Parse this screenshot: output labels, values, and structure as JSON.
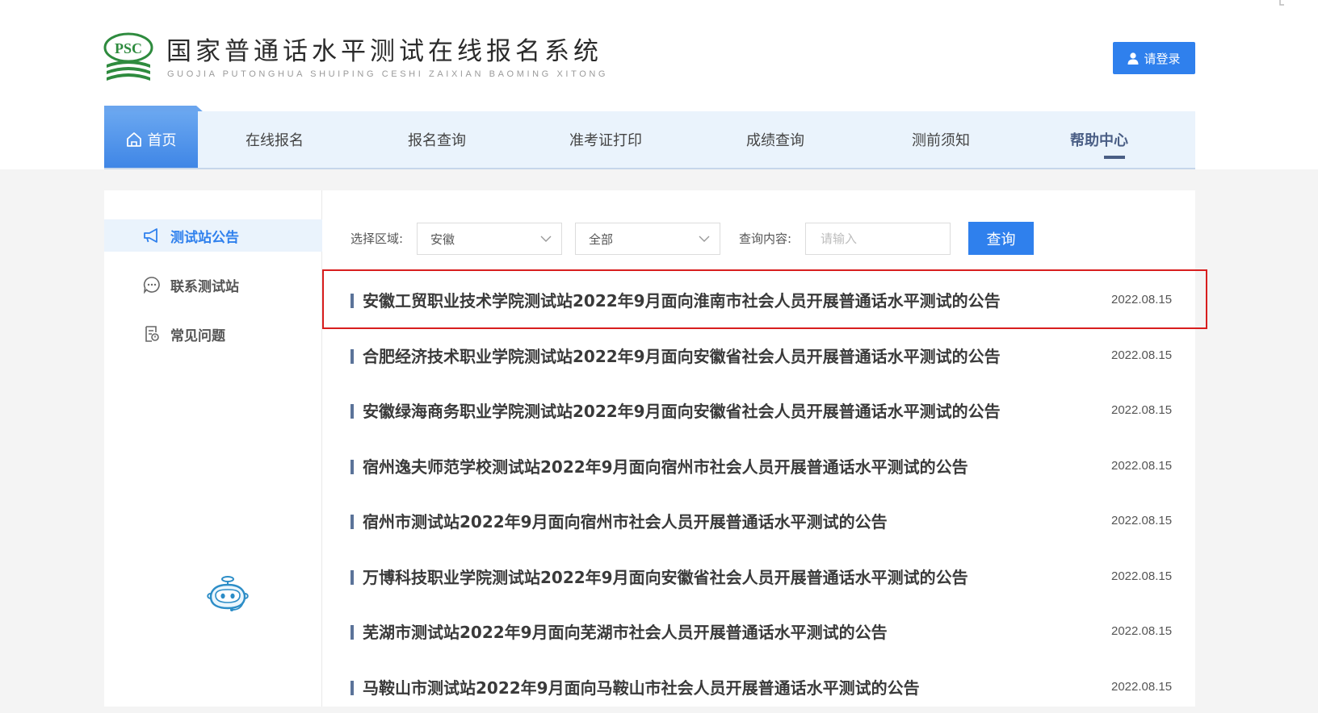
{
  "header": {
    "title": "国家普通话水平测试在线报名系统",
    "subtitle": "GUOJIA PUTONGHUA SHUIPING CESHI ZAIXIAN BAOMING XITONG",
    "logo_text": "PSC",
    "login_label": "请登录",
    "login_icon": "user-icon"
  },
  "nav": {
    "items": [
      {
        "label": "首页",
        "icon": "home-icon"
      },
      {
        "label": "在线报名"
      },
      {
        "label": "报名查询"
      },
      {
        "label": "准考证打印"
      },
      {
        "label": "成绩查询"
      },
      {
        "label": "测前须知"
      },
      {
        "label": "帮助中心"
      }
    ],
    "active_index": 0,
    "selected_index": 6
  },
  "sidebar": {
    "items": [
      {
        "label": "测试站公告",
        "icon": "megaphone-icon"
      },
      {
        "label": "联系测试站",
        "icon": "chat-bubble-icon"
      },
      {
        "label": "常见问题",
        "icon": "faq-document-icon"
      }
    ],
    "active_index": 0,
    "assistant_icon": "robot-assistant-icon"
  },
  "filters": {
    "region_label": "选择区域:",
    "province_value": "安徽",
    "city_value": "全部",
    "query_label": "查询内容:",
    "query_placeholder": "请输入",
    "query_value": "",
    "search_label": "查询"
  },
  "announcements": [
    {
      "title": "安徽工贸职业技术学院测试站2022年9月面向淮南市社会人员开展普通话水平测试的公告",
      "date": "2022.08.15",
      "highlighted": true
    },
    {
      "title": "合肥经济技术职业学院测试站2022年9月面向安徽省社会人员开展普通话水平测试的公告",
      "date": "2022.08.15"
    },
    {
      "title": "安徽绿海商务职业学院测试站2022年9月面向安徽省社会人员开展普通话水平测试的公告",
      "date": "2022.08.15"
    },
    {
      "title": "宿州逸夫师范学校测试站2022年9月面向宿州市社会人员开展普通话水平测试的公告",
      "date": "2022.08.15"
    },
    {
      "title": "宿州市测试站2022年9月面向宿州市社会人员开展普通话水平测试的公告",
      "date": "2022.08.15"
    },
    {
      "title": "万博科技职业学院测试站2022年9月面向安徽省社会人员开展普通话水平测试的公告",
      "date": "2022.08.15"
    },
    {
      "title": "芜湖市测试站2022年9月面向芜湖市社会人员开展普通话水平测试的公告",
      "date": "2022.08.15"
    },
    {
      "title": "马鞍山市测试站2022年9月面向马鞍山市社会人员开展普通话水平测试的公告",
      "date": "2022.08.15"
    }
  ],
  "colors": {
    "accent": "#2f80ed",
    "nav_background": "#eaf3fc",
    "highlight_border": "#d81e1e",
    "logo_green": "#2e8b3e"
  }
}
